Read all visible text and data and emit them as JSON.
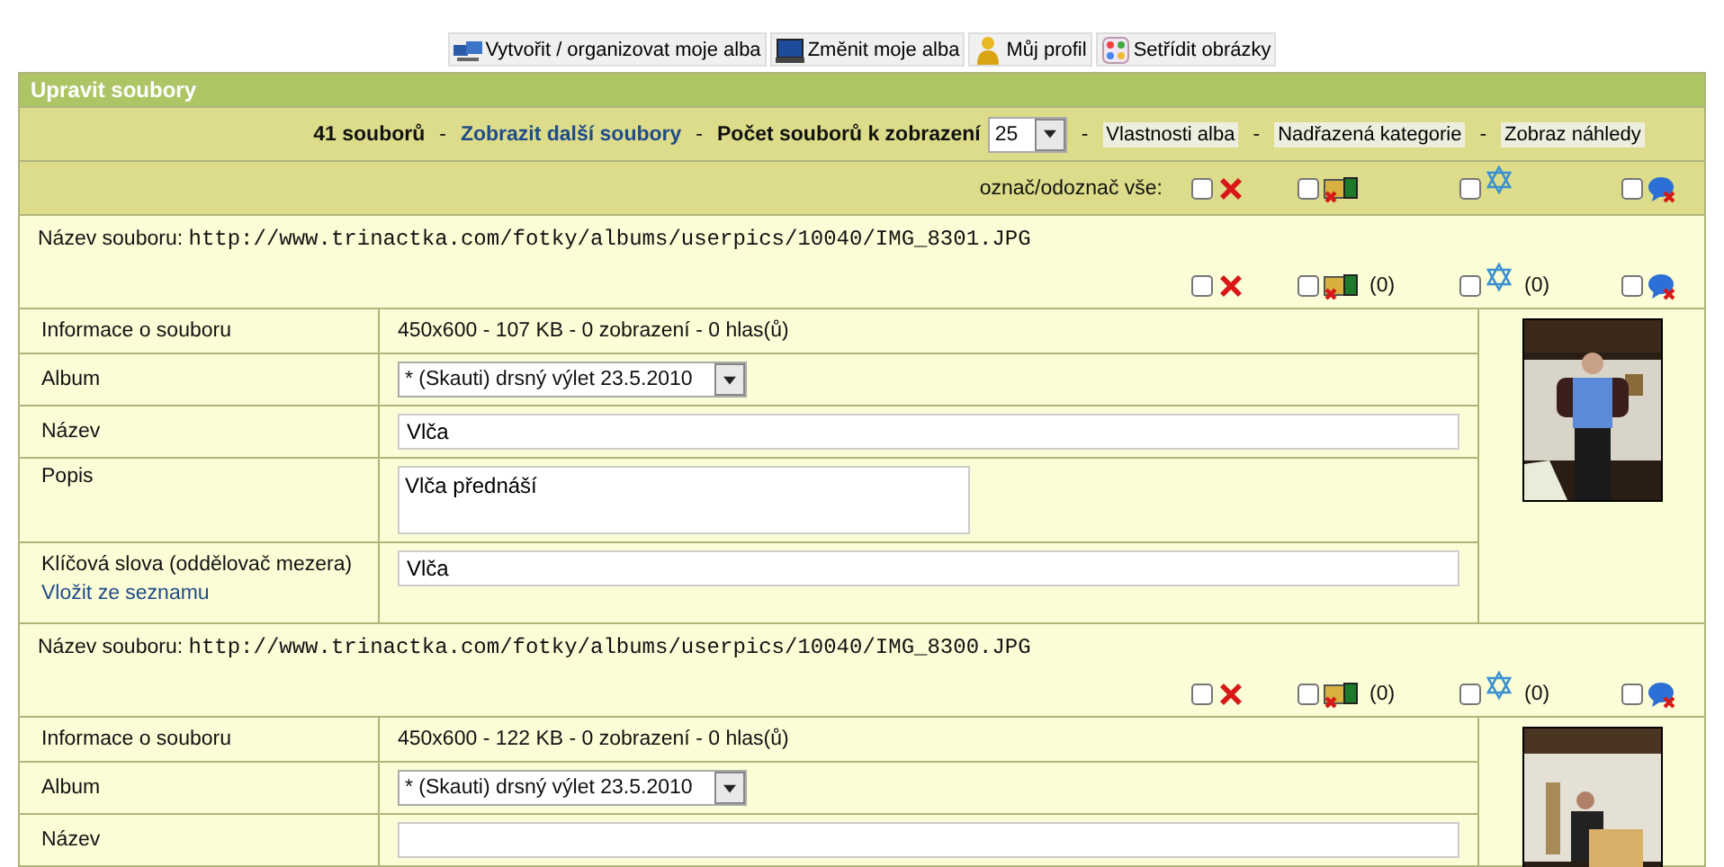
{
  "nav": [
    {
      "label": "Vytvořit / organizovat moje alba"
    },
    {
      "label": "Změnit moje alba"
    },
    {
      "label": "Můj profil"
    },
    {
      "label": "Setřídit obrázky"
    }
  ],
  "panel": {
    "title": "Upravit soubory",
    "toolbar": {
      "count": "41 souborů",
      "sep": "-",
      "more_link": "Zobrazit další soubory",
      "per_page_label": "Počet souborů k zobrazení",
      "per_page": "25",
      "buttons": [
        "Vlastnosti alba",
        "Nadřazená kategorie",
        "Zobraz náhledy"
      ]
    },
    "select_all": {
      "label": "označ/odoznač vše:",
      "actions": [
        {
          "kind": "delete",
          "checked": false
        },
        {
          "kind": "album",
          "checked": false
        },
        {
          "kind": "rating",
          "checked": false
        },
        {
          "kind": "comments",
          "checked": false
        }
      ]
    },
    "files": [
      {
        "label": "Název souboru:",
        "path": "http://www.trinactka.com/fotky/albums/userpics/10040/IMG_8301.JPG",
        "actions": [
          {
            "kind": "delete",
            "checked": false
          },
          {
            "kind": "album",
            "checked": false,
            "count": "(0)"
          },
          {
            "kind": "rating",
            "checked": false,
            "count": "(0)"
          },
          {
            "kind": "comments",
            "checked": false
          }
        ],
        "thumbnail": {
          "kind": "picture"
        },
        "rows": [
          {
            "kind": "text",
            "label": "Informace o souboru",
            "value": "450x600 - 107 KB - 0 zobrazení - 0 hlas(ů)"
          },
          {
            "kind": "select",
            "label": "Album",
            "value": "* (Skauti) drsný výlet 23.5.2010"
          },
          {
            "kind": "input",
            "label": "Název",
            "value": "Vlča"
          },
          {
            "kind": "textarea",
            "label": "Popis",
            "value": "Vlča přednáší"
          },
          {
            "kind": "keywords",
            "label": "Klíčová slova (oddělovač mezera)",
            "link": "Vložit ze seznamu",
            "value": "Vlča"
          }
        ]
      },
      {
        "label": "Název souboru:",
        "path": "http://www.trinactka.com/fotky/albums/userpics/10040/IMG_8300.JPG",
        "actions": [
          {
            "kind": "delete",
            "checked": false
          },
          {
            "kind": "album",
            "checked": false,
            "count": "(0)"
          },
          {
            "kind": "rating",
            "checked": false,
            "count": "(0)"
          },
          {
            "kind": "comments",
            "checked": false
          }
        ],
        "thumbnail": {
          "kind": "picture"
        },
        "rows": [
          {
            "kind": "text",
            "label": "Informace o souboru",
            "value": "450x600 - 122 KB - 0 zobrazení - 0 hlas(ů)"
          },
          {
            "kind": "select",
            "label": "Album",
            "value": "* (Skauti) drsný výlet 23.5.2010"
          },
          {
            "kind": "input",
            "label": "Název"
          }
        ]
      }
    ]
  }
}
